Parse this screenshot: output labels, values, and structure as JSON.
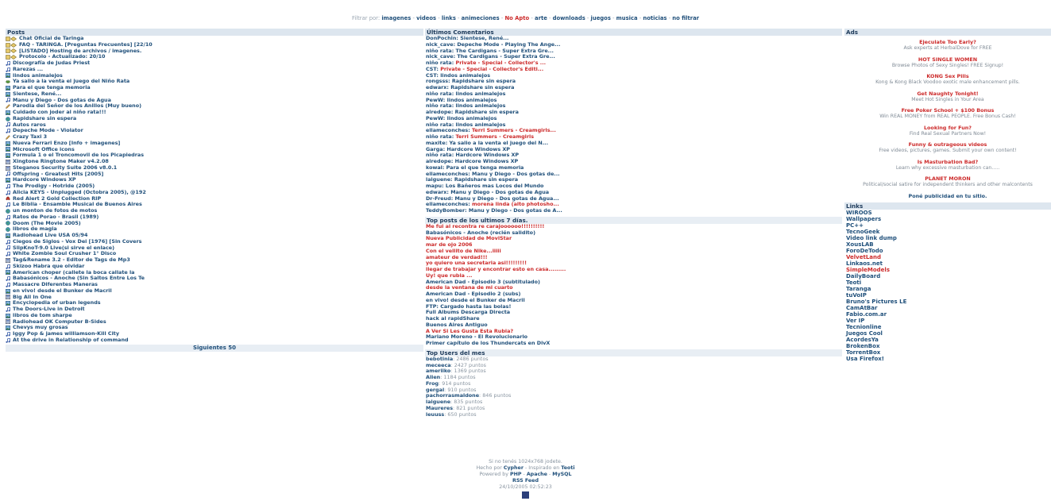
{
  "filter": {
    "label": "Filtrar por:",
    "items": [
      {
        "text": "imagenes",
        "red": false
      },
      {
        "text": "videos",
        "red": false
      },
      {
        "text": "links",
        "red": false
      },
      {
        "text": "animeciones",
        "red": false
      },
      {
        "text": "No Apto",
        "red": true
      },
      {
        "text": "arte",
        "red": false
      },
      {
        "text": "downloads",
        "red": false
      },
      {
        "text": "juegos",
        "red": false
      },
      {
        "text": "musica",
        "red": false
      },
      {
        "text": "noticias",
        "red": false
      },
      {
        "text": "no filtrar",
        "red": false
      }
    ]
  },
  "posts": {
    "heading": "Posts",
    "items": [
      {
        "icon": "sticky-icon",
        "text": "Chat Oficial de Taringa"
      },
      {
        "icon": "sticky-icon",
        "text": "FAQ - TARINGA. [Preguntas Frecuentes] [22/10"
      },
      {
        "icon": "sticky-icon",
        "text": "[LISTADO] Hosting de archivos / imagenes."
      },
      {
        "icon": "sticky-icon",
        "text": "Protocolo - Actualizado: 20/10"
      },
      {
        "icon": "music-icon",
        "text": "Discografía de Judas Priest"
      },
      {
        "icon": "music-icon",
        "text": "Rarezas ..."
      },
      {
        "icon": "image-icon",
        "text": "lindos animalejos"
      },
      {
        "icon": "link-icon",
        "text": "Ya salio a la venta el juego del Niño Rata"
      },
      {
        "icon": "image-icon",
        "text": "Para el que tenga memoria"
      },
      {
        "icon": "image-icon",
        "text": "Sientese, René..."
      },
      {
        "icon": "music-icon",
        "text": "Manu y Diego - Dos gotas de Agua"
      },
      {
        "icon": "pencil-icon",
        "text": "Parodia del Señor de los Anillos (Muy bueno)"
      },
      {
        "icon": "image-icon",
        "text": "Cuidado con joder al niño rata!!!"
      },
      {
        "icon": "globe-icon",
        "text": "Rapidshare sin espera"
      },
      {
        "icon": "music-icon",
        "text": "Autos raros"
      },
      {
        "icon": "music-icon",
        "text": "Depeche Mode - Violator"
      },
      {
        "icon": "pencil-icon",
        "text": "Crazy Taxi 3"
      },
      {
        "icon": "image-icon",
        "text": "Nueva Ferrari Enzo [Info + imagenes]"
      },
      {
        "icon": "image-icon",
        "text": "Microsoft Office icons"
      },
      {
        "icon": "image-icon",
        "text": "Formula 1 o el Troncomovil de los Picapiedras"
      },
      {
        "icon": "download-icon",
        "text": "Xingtone Ringtone Maker v4.2.08"
      },
      {
        "icon": "download-icon",
        "text": "Steganos Security Suite 2006 v8.0.1"
      },
      {
        "icon": "music-icon",
        "text": "Offspring - Greatest Hits [2005]"
      },
      {
        "icon": "image-icon",
        "text": "Hardcore Windows XP"
      },
      {
        "icon": "music-icon",
        "text": "The Prodigy - Hotride (2005)"
      },
      {
        "icon": "music-icon",
        "text": "Alicia KEYS - Unplugged (Octobra 2005), @192"
      },
      {
        "icon": "game-icon",
        "text": "Red Alert 2 Gold Collection RIP"
      },
      {
        "icon": "music-icon",
        "text": "Le Biblia - Ensamble Musical de Buenos Aires"
      },
      {
        "icon": "globe-icon",
        "text": "un monton de fotos de motos"
      },
      {
        "icon": "music-icon",
        "text": "Ratos de Porao - Brasil (1989)"
      },
      {
        "icon": "globe-icon",
        "text": "Doom (The Movie 2005)"
      },
      {
        "icon": "globe-icon",
        "text": "libros de magia"
      },
      {
        "icon": "image-icon",
        "text": "Radiohead Live USA 05/94"
      },
      {
        "icon": "music-icon",
        "text": "Ciegos de Siglos - Vox Dei [1976] [Sin Covers"
      },
      {
        "icon": "music-icon",
        "text": "SlipKnoT-9.0 Live(si sirve el enlace)"
      },
      {
        "icon": "music-icon",
        "text": "White Zombie Soul Crusher 1° Disco"
      },
      {
        "icon": "download-icon",
        "text": "Tag&Rename 3.2 - Editor de Tags de Mp3"
      },
      {
        "icon": "music-icon",
        "text": "Skizoo Habra que olvidar"
      },
      {
        "icon": "image-icon",
        "text": "American choper (callete la boca callate la"
      },
      {
        "icon": "music-icon",
        "text": "Babasónicos - Anoche (Sin Saltos Entre Los Te"
      },
      {
        "icon": "music-icon",
        "text": "Massacre Diferentes Maneras"
      },
      {
        "icon": "image-icon",
        "text": "en vivo! desde el Bunker de Macril"
      },
      {
        "icon": "download-icon",
        "text": "Big All In One"
      },
      {
        "icon": "image-icon",
        "text": "Encyclopedia of urban legends"
      },
      {
        "icon": "music-icon",
        "text": "The Doors-Live in Detroit"
      },
      {
        "icon": "image-icon",
        "text": "libros de tom sharpe"
      },
      {
        "icon": "download-icon",
        "text": "Radiohead OK Computer B-Sides"
      },
      {
        "icon": "image-icon",
        "text": "Chevys muy grosas"
      },
      {
        "icon": "music-icon",
        "text": "Iggy Pop & james williamson-Kill City"
      },
      {
        "icon": "music-icon",
        "text": "At the drive in Relationship of command"
      }
    ],
    "next": "Siguientes 50"
  },
  "comments": {
    "heading": "Últimos Comentarios",
    "items": [
      {
        "user": "DonPochin",
        "text": "Sientese, René...",
        "red": false
      },
      {
        "user": "nick_cave",
        "text": "Depeche Mode - Playing The Ange...",
        "red": false
      },
      {
        "user": "niño rata",
        "text": "The Cardigans - Super Extra Gre...",
        "red": false
      },
      {
        "user": "nick_cave",
        "text": "The Cardigans - Super Extra Gre...",
        "red": false
      },
      {
        "user": "niño rata",
        "text": "Private - Special - Collector's ...",
        "red": true
      },
      {
        "user": "CST",
        "text": "Private - Special - Collector's Editi...",
        "red": true
      },
      {
        "user": "CST",
        "text": "lindos animalejos",
        "red": false
      },
      {
        "user": "rongsss",
        "text": "Rapidshare sin espera",
        "red": false
      },
      {
        "user": "edwarx",
        "text": "Rapidshare sin espera",
        "red": false
      },
      {
        "user": "niño rata",
        "text": "lindos animalejos",
        "red": false
      },
      {
        "user": "PewW",
        "text": "lindos animalejos",
        "red": false
      },
      {
        "user": "niño rata",
        "text": "lindos animalejos",
        "red": false
      },
      {
        "user": "alredope",
        "text": "Rapidshare sin espera",
        "red": false
      },
      {
        "user": "PewW",
        "text": "lindos animalejos",
        "red": false
      },
      {
        "user": "niño rata",
        "text": "lindos animalejos",
        "red": false
      },
      {
        "user": "ellameconches",
        "text": "Terri Summers - Creamgirls...",
        "red": true
      },
      {
        "user": "niño rata",
        "text": "Terri Summers - Creamgirls",
        "red": true
      },
      {
        "user": "maxite",
        "text": "Ya salio a la venta el juego del N...",
        "red": false
      },
      {
        "user": "Garga",
        "text": "Hardcore Windows XP",
        "red": false
      },
      {
        "user": "niño rata",
        "text": "Hardcore Windows XP",
        "red": false
      },
      {
        "user": "alredope",
        "text": "Hardcore Windows XP",
        "red": false
      },
      {
        "user": "kowal",
        "text": "Para el que tenga memoria",
        "red": false
      },
      {
        "user": "ellameconches",
        "text": "Manu y Diego - Dos gotas de...",
        "red": false
      },
      {
        "user": "laiguene",
        "text": "Rapidshare sin espera",
        "red": false
      },
      {
        "user": "mapu",
        "text": "Los Bañeros mas Locos del Mundo",
        "red": false
      },
      {
        "user": "edwarx",
        "text": "Manu y Diego - Dos gotas de Agua",
        "red": false
      },
      {
        "user": "Dr-Freud",
        "text": "Manu y Diego - Dos gotas de Agua...",
        "red": false
      },
      {
        "user": "ellameconches",
        "text": "morena linda (alto photosho...",
        "red": true
      },
      {
        "user": "TeddyBomber",
        "text": "Manu y Diego - Dos gotas de A...",
        "red": false
      }
    ]
  },
  "top_posts": {
    "heading": "Top posts de los ultimos 7 días.",
    "items": [
      {
        "text": "Me fui al recontra re carajoooooo!!!!!!!!!!",
        "red": true
      },
      {
        "text": "Babasónicos - Anoche (recién salidito)",
        "red": false
      },
      {
        "text": "Nueva Publicidad de MoviStar",
        "red": true
      },
      {
        "text": "mar de ojo 2006",
        "red": true
      },
      {
        "text": "Con el vellito de Nike...iiiii",
        "red": true
      },
      {
        "text": "amateur de verdad!!!",
        "red": true
      },
      {
        "text": "yo quiero una secretaria asi!!!!!!!!!",
        "red": true
      },
      {
        "text": "llegar de trabajar y encontrar esto en casa.........",
        "red": true
      },
      {
        "text": "Uy! que rubia ...",
        "red": true
      },
      {
        "text": "American Dad - Episodio 3 (subtitulado)",
        "red": false
      },
      {
        "text": "desde la ventana de mi cuarto",
        "red": true
      },
      {
        "text": "American Dad - Episodio 2 (subs)",
        "red": false
      },
      {
        "text": "en vivo! desde el Bunker de Macril",
        "red": false
      },
      {
        "text": "FTP: Cargado hasta las bolas!",
        "red": false
      },
      {
        "text": "Full Albums Descarga Directa",
        "red": false
      },
      {
        "text": "hack al rapidShare",
        "red": false
      },
      {
        "text": "Buenos Aires Antiguo",
        "red": false
      },
      {
        "text": "A Ver Si Les Gusta Esta Rubia?",
        "red": true
      },
      {
        "text": "Mariano Moreno - El Revolucionario",
        "red": false
      },
      {
        "text": "Primer capítulo de los Thundercats en DivX",
        "red": false
      }
    ]
  },
  "top_users": {
    "heading": "Top Users del mes",
    "items": [
      {
        "user": "bebotinia",
        "points": "2486 puntos"
      },
      {
        "user": "meceeca",
        "points": "2427 puntos"
      },
      {
        "user": "ameriiko",
        "points": "1369 puntos"
      },
      {
        "user": "Alien",
        "points": "1184 puntos"
      },
      {
        "user": "Frog",
        "points": "914 puntos"
      },
      {
        "user": "gergal",
        "points": "910 puntos"
      },
      {
        "user": "pachorrasmaldone",
        "points": "846 puntos"
      },
      {
        "user": "laiguene",
        "points": "835 puntos"
      },
      {
        "user": "Maureres",
        "points": "821 puntos"
      },
      {
        "user": "leuuss",
        "points": "650 puntos"
      }
    ]
  },
  "ads": {
    "heading": "Ads",
    "items": [
      {
        "title": "Ejeculate Too Early?",
        "desc": "Ask experts at HerbalDove for FREE"
      },
      {
        "title": "HOT SINGLE WOMEN",
        "desc": "Browse Photos of Sexy Singles! FREE Signup!"
      },
      {
        "title": "KONG Sex Pills",
        "desc": "Kong & Kong Black Voodoo exotic male enhancement pills."
      },
      {
        "title": "Get Naughty Tonight!",
        "desc": "Meet Hot Singles in Your Area"
      },
      {
        "title": "Free Poker School + $100 Bonus",
        "desc": "Win REAL MONEY from REAL PEOPLE. Free Bonus Cash!"
      },
      {
        "title": "Looking for Fun?",
        "desc": "Find Real Sexual Partners Now!"
      },
      {
        "title": "Funny & outrageous videos",
        "desc": "Free videos, pictures, games. Submit your own content!"
      },
      {
        "title": "Is Masturbation Bad?",
        "desc": "Learn why excessive masturbation can....."
      },
      {
        "title": "PLANET MORON",
        "desc": "Political/social satire for independent thinkers and other malcontents"
      }
    ],
    "footer": "Poné publicidad en tu sitio."
  },
  "links": {
    "heading": "Links",
    "items": [
      {
        "text": "WIROOS",
        "red": false
      },
      {
        "text": "Wallpapers",
        "red": false
      },
      {
        "text": "PC++",
        "red": false
      },
      {
        "text": "TecnoGeek",
        "red": false
      },
      {
        "text": "Video link dump",
        "red": false
      },
      {
        "text": "XousLAB",
        "red": false
      },
      {
        "text": "ForoDeTodo",
        "red": false
      },
      {
        "text": "VelvetLand",
        "red": true
      },
      {
        "text": "Linkaos.net",
        "red": false
      },
      {
        "text": "SimpleModels",
        "red": true
      },
      {
        "text": "DailyBoard",
        "red": false
      },
      {
        "text": "Teoti",
        "red": false
      },
      {
        "text": "Taranga",
        "red": false
      },
      {
        "text": "tuVoIP",
        "red": false
      },
      {
        "text": "Bruno's Pictures LE",
        "red": false
      },
      {
        "text": "CamAtBar",
        "red": false
      },
      {
        "text": "Fabio.com.ar",
        "red": false
      },
      {
        "text": "Ver IP",
        "red": false
      },
      {
        "text": "Tecnionline",
        "red": false
      },
      {
        "text": "Juegos Cool",
        "red": false
      },
      {
        "text": "AcordesYa",
        "red": false
      },
      {
        "text": "BrokenBox",
        "red": false
      },
      {
        "text": "TorrentBox",
        "red": false
      },
      {
        "text": "Usa Firefox!",
        "red": false
      }
    ]
  },
  "footer": {
    "line1": "Si no tenés 1024x768 jodete.",
    "made_by_prefix": "Hecho por",
    "made_by": "Cypher",
    "inspired_prefix": "Inspirado en",
    "inspired": "Teoti",
    "powered_prefix": "Powered by",
    "powered": [
      "PHP",
      "Apache",
      "MySQL"
    ],
    "rss": "RSS Feed",
    "timestamp": "24/10/2005 02:52:23"
  },
  "colors": {
    "text": "#1f4f7a",
    "red": "#cc2a2a",
    "header_bg": "#dde6ef",
    "muted": "#8894a0"
  }
}
